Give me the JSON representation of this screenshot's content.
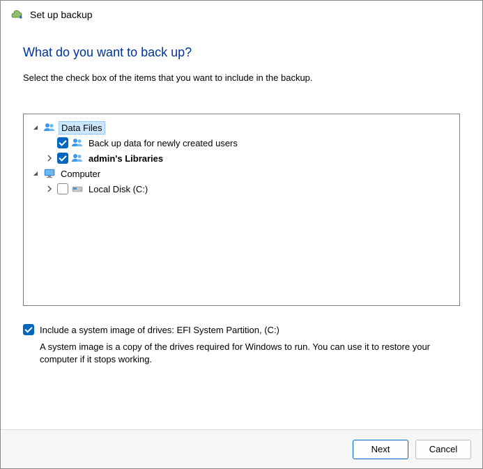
{
  "window": {
    "title": "Set up backup"
  },
  "page": {
    "heading": "What do you want to back up?",
    "instruction": "Select the check box of the items that you want to include in the backup."
  },
  "tree": {
    "data_files": {
      "label": "Data Files",
      "children": {
        "newly_created": {
          "label": "Back up data for newly created users",
          "checked": true
        },
        "admin_libraries": {
          "label": "admin's Libraries",
          "checked": true
        }
      }
    },
    "computer": {
      "label": "Computer",
      "children": {
        "local_disk": {
          "label": "Local Disk (C:)",
          "checked": false
        }
      }
    }
  },
  "system_image": {
    "checked": true,
    "label": "Include a system image of drives: EFI System Partition, (C:)",
    "description": "A system image is a copy of the drives required for Windows to run. You can use it to restore your computer if it stops working."
  },
  "footer": {
    "next": "Next",
    "cancel": "Cancel"
  }
}
